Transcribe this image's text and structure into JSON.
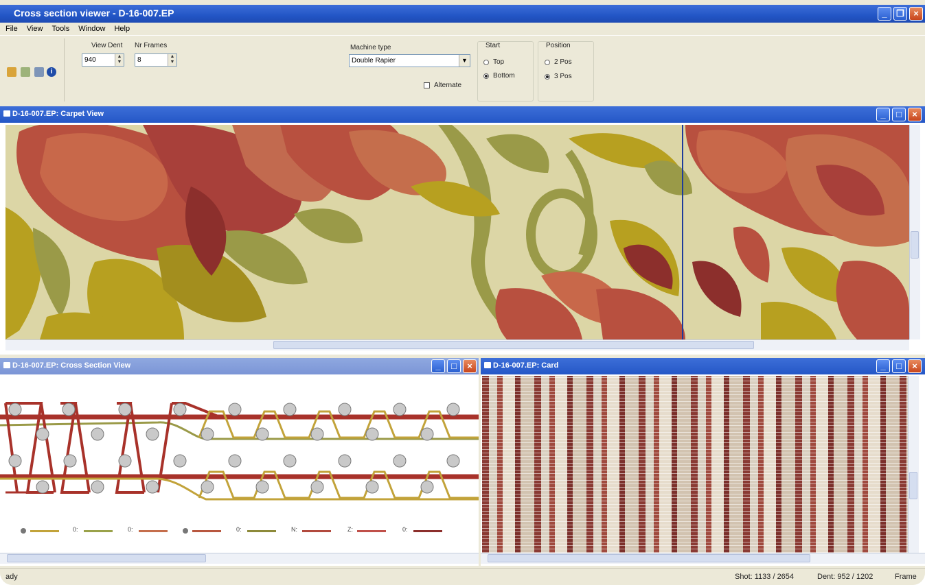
{
  "app": {
    "title": "Cross section viewer - D-16-007.EP"
  },
  "menu": [
    "File",
    "View",
    "Tools",
    "Window",
    "Help"
  ],
  "toolbar": {
    "view_dent_label": "View Dent",
    "view_dent_value": "940",
    "nr_frames_label": "Nr Frames",
    "nr_frames_value": "8",
    "machine_type_label": "Machine type",
    "machine_type_value": "Double Rapier",
    "alternate_label": "Alternate",
    "start_label": "Start",
    "start_options": [
      "Top",
      "Bottom"
    ],
    "start_selected": "Bottom",
    "position_label": "Position",
    "position_options": [
      "2 Pos",
      "3 Pos"
    ],
    "position_selected": "3 Pos"
  },
  "windows": {
    "carpet": {
      "title": "D-16-007.EP: Carpet View"
    },
    "cross": {
      "title": "D-16-007.EP: Cross Section View"
    },
    "card": {
      "title": "D-16-007.EP: Card"
    }
  },
  "legend": [
    {
      "label": "",
      "color": "#c2a33a"
    },
    {
      "label": "0:",
      "color": "#9aa24a"
    },
    {
      "label": "0:",
      "color": "#c56e4c"
    },
    {
      "label": "",
      "color": "#b8573f"
    },
    {
      "label": "0:",
      "color": "#8d8a3a"
    },
    {
      "label": "N:",
      "color": "#b24a3e"
    },
    {
      "label": "Z:",
      "color": "#c0504a"
    },
    {
      "label": "0:",
      "color": "#8c2f2c"
    }
  ],
  "status": {
    "left": "ady",
    "shot": "Shot: 1133 / 2654",
    "dent": "Dent: 952 / 1202",
    "frame": "Frame"
  },
  "colors": {
    "title_blue": "#2356c6",
    "carpet_bg": "#dcd6a6",
    "rose_red": "#b8503f",
    "leaf_gold": "#b7a020",
    "leaf_olive": "#9a9a48",
    "warp_red": "#a8322a"
  }
}
